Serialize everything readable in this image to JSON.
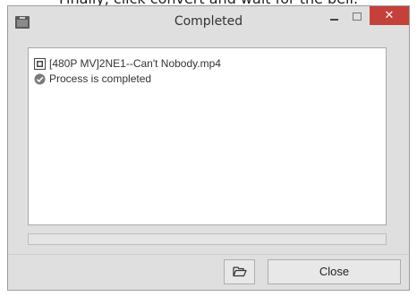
{
  "caption": {
    "text": "Finally, click convert and wait for the bell."
  },
  "window": {
    "title": "Completed",
    "title_icon": "app-icon",
    "controls": {
      "minimize_icon": "minimize-icon",
      "maximize_icon": "maximize-icon",
      "close_glyph": "✕"
    }
  },
  "log": {
    "items": [
      {
        "icon": "video-file-icon",
        "text": "[480P MV]2NE1--Can't Nobody.mp4"
      },
      {
        "icon": "check-circle-icon",
        "text": "Process is completed"
      }
    ]
  },
  "progress": {
    "value": 0
  },
  "footer": {
    "open_folder_icon": "open-folder-icon",
    "close_label": "Close"
  },
  "colors": {
    "window_bg": "#dfdfdf",
    "close_button_red": "#c6403a"
  }
}
